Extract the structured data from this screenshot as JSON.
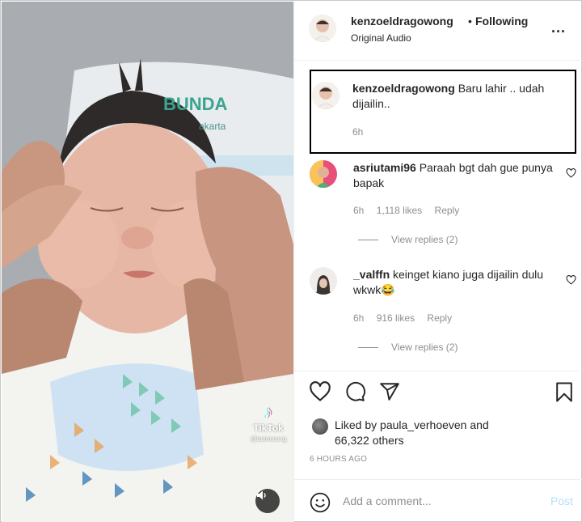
{
  "media": {
    "watermark_app": "TikTok",
    "watermark_user": "@baimwong",
    "blanket_text": "BUNDA",
    "blanket_subtext": "akarta"
  },
  "header": {
    "username": "kenzoeldragowong",
    "separator": "•",
    "follow_status": "Following",
    "audio": "Original Audio",
    "more": "..."
  },
  "caption": {
    "username": "kenzoeldragowong",
    "text": "Baru lahir .. udah dijailin..",
    "time": "6h"
  },
  "comments": [
    {
      "username": "asriutami96",
      "text": "Paraah bgt dah gue punya bapak",
      "time": "6h",
      "likes": "1,118 likes",
      "reply": "Reply",
      "view_replies": "View replies (2)"
    },
    {
      "username": "_valffn",
      "text": "keinget kiano juga dijailin dulu wkwk😂",
      "time": "6h",
      "likes": "916 likes",
      "reply": "Reply",
      "view_replies": "View replies (2)"
    }
  ],
  "likes": {
    "prefix": "Liked by",
    "user": "paula_verhoeven",
    "connector": "and",
    "others": "66,322 others"
  },
  "timestamp": "6 HOURS AGO",
  "add_comment": {
    "placeholder": "Add a comment...",
    "post_label": "Post"
  },
  "colors": {
    "text": "#262626",
    "muted": "#8e8e8e",
    "post_disabled": "#b2dffc",
    "border": "#efefef"
  }
}
